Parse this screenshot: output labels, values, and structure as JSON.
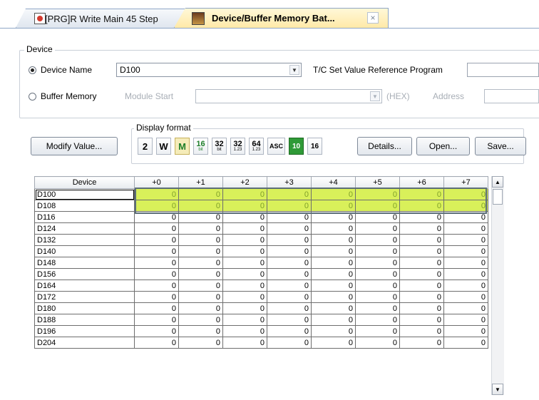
{
  "tabs": [
    {
      "label": "[PRG]R Write Main 45 Step"
    },
    {
      "label": "Device/Buffer Memory Bat...",
      "close": "×"
    }
  ],
  "device_group": {
    "title": "Device",
    "device_name_label": "Device Name",
    "device_name_value": "D100",
    "tc_label": "T/C Set Value Reference Program",
    "buffer_label": "Buffer Memory",
    "module_start_label": "Module Start",
    "hex_label": "(HEX)",
    "address_label": "Address"
  },
  "toolbar": {
    "modify_label": "Modify Value...",
    "display_format_title": "Display format",
    "formats": [
      {
        "id": "bin",
        "label": "2"
      },
      {
        "id": "word",
        "label": "W"
      },
      {
        "id": "mixed",
        "label": "M"
      },
      {
        "id": "16bit",
        "top": "16",
        "bottom": "bit"
      },
      {
        "id": "32bit",
        "top": "32",
        "bottom": "bit"
      },
      {
        "id": "32float",
        "top": "32",
        "bottom": "1.23"
      },
      {
        "id": "64float",
        "top": "64",
        "bottom": "1.23"
      },
      {
        "id": "asc",
        "label": "ASC"
      },
      {
        "id": "dec",
        "label": "10"
      },
      {
        "id": "hex",
        "label": "16"
      }
    ],
    "details_label": "Details...",
    "open_label": "Open...",
    "save_label": "Save..."
  },
  "grid": {
    "device_header": "Device",
    "offset_headers": [
      "+0",
      "+1",
      "+2",
      "+3",
      "+4",
      "+5",
      "+6",
      "+7"
    ],
    "rows": [
      {
        "device": "D100",
        "values": [
          "0",
          "0",
          "0",
          "0",
          "0",
          "0",
          "0",
          "0"
        ]
      },
      {
        "device": "D108",
        "values": [
          "0",
          "0",
          "0",
          "0",
          "0",
          "0",
          "0",
          "0"
        ]
      },
      {
        "device": "D116",
        "values": [
          "0",
          "0",
          "0",
          "0",
          "0",
          "0",
          "0",
          "0"
        ]
      },
      {
        "device": "D124",
        "values": [
          "0",
          "0",
          "0",
          "0",
          "0",
          "0",
          "0",
          "0"
        ]
      },
      {
        "device": "D132",
        "values": [
          "0",
          "0",
          "0",
          "0",
          "0",
          "0",
          "0",
          "0"
        ]
      },
      {
        "device": "D140",
        "values": [
          "0",
          "0",
          "0",
          "0",
          "0",
          "0",
          "0",
          "0"
        ]
      },
      {
        "device": "D148",
        "values": [
          "0",
          "0",
          "0",
          "0",
          "0",
          "0",
          "0",
          "0"
        ]
      },
      {
        "device": "D156",
        "values": [
          "0",
          "0",
          "0",
          "0",
          "0",
          "0",
          "0",
          "0"
        ]
      },
      {
        "device": "D164",
        "values": [
          "0",
          "0",
          "0",
          "0",
          "0",
          "0",
          "0",
          "0"
        ]
      },
      {
        "device": "D172",
        "values": [
          "0",
          "0",
          "0",
          "0",
          "0",
          "0",
          "0",
          "0"
        ]
      },
      {
        "device": "D180",
        "values": [
          "0",
          "0",
          "0",
          "0",
          "0",
          "0",
          "0",
          "0"
        ]
      },
      {
        "device": "D188",
        "values": [
          "0",
          "0",
          "0",
          "0",
          "0",
          "0",
          "0",
          "0"
        ]
      },
      {
        "device": "D196",
        "values": [
          "0",
          "0",
          "0",
          "0",
          "0",
          "0",
          "0",
          "0"
        ]
      },
      {
        "device": "D204",
        "values": [
          "0",
          "0",
          "0",
          "0",
          "0",
          "0",
          "0",
          "0"
        ]
      }
    ]
  },
  "colors": {
    "highlight_rows": "#d9f05a",
    "active_tab": "#ffe9a8",
    "format_green": "#2f9a37"
  }
}
